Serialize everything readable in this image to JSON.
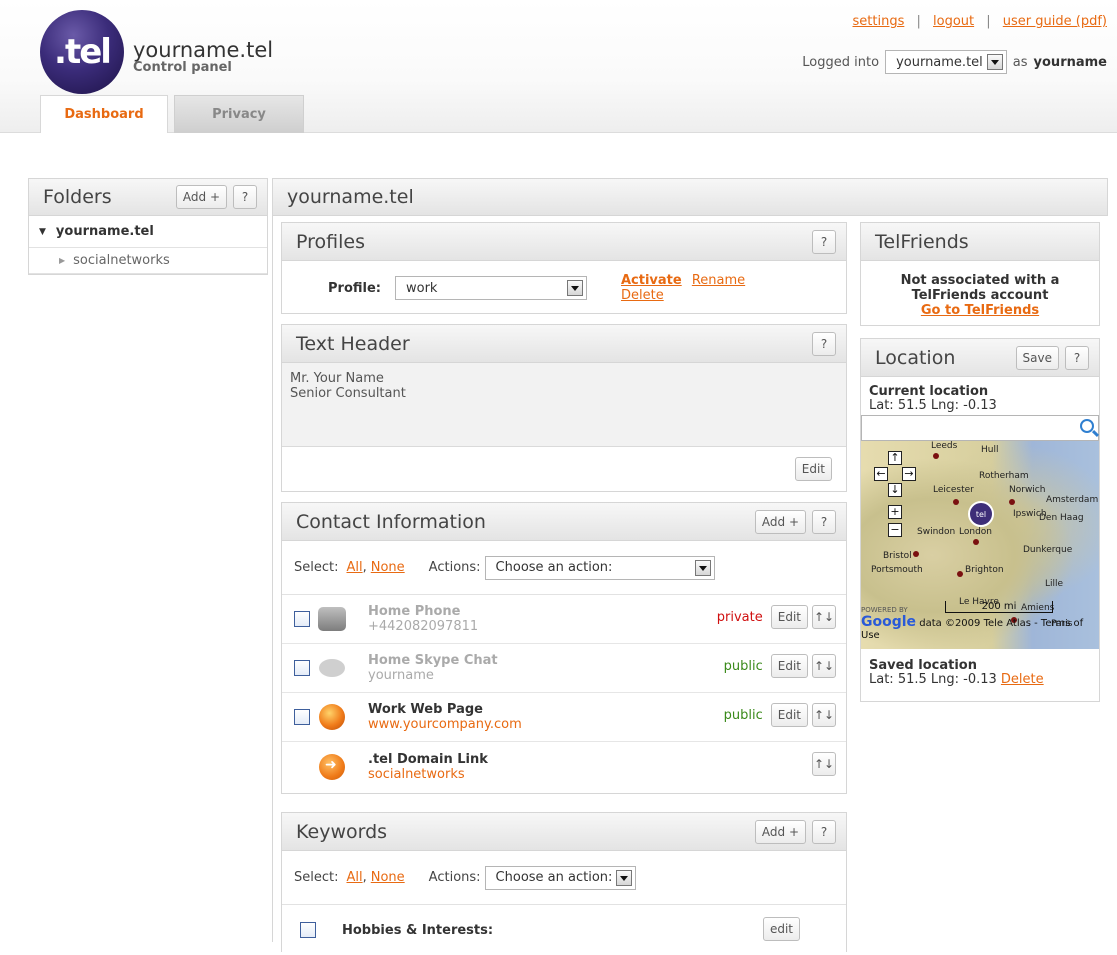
{
  "header": {
    "logo_text": ".tel",
    "site_name": "yourname.tel",
    "site_subtitle": "Control panel",
    "links": {
      "settings": "settings",
      "logout": "logout",
      "user_guide": "user guide (pdf)",
      "separator": "|"
    },
    "logged_into_label": "Logged into",
    "logged_domain": "yourname.tel",
    "as_label": "as",
    "username": "yourname",
    "tabs": [
      {
        "label": "Dashboard",
        "active": true
      },
      {
        "label": "Privacy",
        "active": false
      }
    ]
  },
  "folders": {
    "title": "Folders",
    "add_label": "Add +",
    "help_label": "?",
    "root": "yourname.tel",
    "children": [
      "socialnetworks"
    ]
  },
  "main": {
    "title": "yourname.tel"
  },
  "profiles": {
    "title": "Profiles",
    "help_label": "?",
    "profile_label": "Profile:",
    "selected_profile": "work",
    "activate": "Activate",
    "rename": "Rename",
    "delete": "Delete"
  },
  "text_header": {
    "title": "Text Header",
    "help_label": "?",
    "lines": [
      "Mr. Your Name",
      "Senior Consultant"
    ],
    "edit_label": "Edit"
  },
  "contact_info": {
    "title": "Contact Information",
    "add_label": "Add +",
    "help_label": "?",
    "select_label": "Select:",
    "all": "All",
    "none": "None",
    "actions_label": "Actions:",
    "action_selected": "Choose an action:",
    "edit_label": "Edit",
    "reorder_label": "↑↓",
    "items": [
      {
        "icon": "phone-icon",
        "title": "Home Phone",
        "value": "+442082097811",
        "visibility": "private"
      },
      {
        "icon": "chat-icon",
        "title": "Home Skype Chat",
        "value": "yourname",
        "visibility": "public"
      },
      {
        "icon": "web-icon",
        "title": "Work Web Page",
        "value": "www.yourcompany.com",
        "visibility": "public"
      },
      {
        "icon": "link-icon",
        "title": ".tel Domain Link",
        "value": "socialnetworks"
      }
    ]
  },
  "keywords": {
    "title": "Keywords",
    "add_label": "Add +",
    "help_label": "?",
    "select_label": "Select:",
    "all": "All",
    "none": "None",
    "actions_label": "Actions:",
    "action_selected": "Choose an action:",
    "items": [
      {
        "title": "Hobbies & Interests:",
        "edit_label": "edit"
      }
    ]
  },
  "telfriends": {
    "title": "TelFriends",
    "message_line1": "Not associated with a",
    "message_line2": "TelFriends account",
    "link": "Go to TelFriends"
  },
  "location": {
    "title": "Location",
    "save_label": "Save",
    "help_label": "?",
    "current_label": "Current location",
    "current_coords": "Lat: 51.5 Lng: -0.13",
    "map_labels": [
      "Leeds",
      "Hull",
      "Rotherham",
      "Leicester",
      "Norwich",
      "Amsterdam",
      "Ipswich",
      "Den Haag",
      "Swindon",
      "London",
      "Bristol",
      "Dunkerque",
      "Portsmouth",
      "Brighton",
      "Lille",
      "Le Havre",
      "Amiens",
      "Paris"
    ],
    "map_scale": "200 mi",
    "map_powered_by": "POWERED BY",
    "map_brand": "Google",
    "map_copyright": "data ©2009 Tele Atlas - Terms of Use",
    "saved_label": "Saved location",
    "saved_coords": "Lat: 51.5 Lng: -0.13",
    "delete_label": "Delete"
  }
}
